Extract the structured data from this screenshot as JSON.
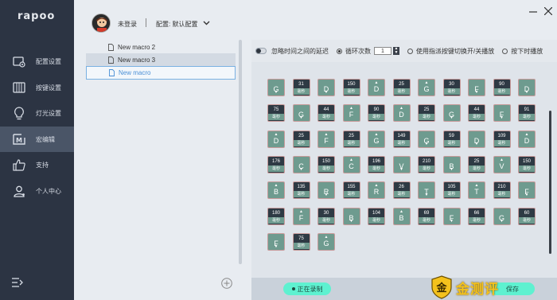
{
  "app": {
    "logo": "rapoo"
  },
  "sidebar": {
    "items": [
      {
        "label": "配置设置",
        "icon": "config-icon"
      },
      {
        "label": "按键设置",
        "icon": "keys-icon"
      },
      {
        "label": "灯光设置",
        "icon": "light-icon"
      },
      {
        "label": "宏编辑",
        "icon": "macro-icon"
      },
      {
        "label": "支持",
        "icon": "thumbs-up-icon"
      },
      {
        "label": "个人中心",
        "icon": "user-icon"
      }
    ],
    "active_index": 3,
    "collapse_icon": "menu-collapse-icon"
  },
  "header": {
    "login_status": "未登录",
    "profile_label": "配置: 默认配置"
  },
  "macro_list": {
    "items": [
      "New macro 2",
      "New macro 3",
      "New macro"
    ],
    "selected_index": 2
  },
  "editor": {
    "options": {
      "ignore_delay": "忽略时间之间的延迟",
      "loop_count_label": "循环次数",
      "loop_count_value": "1",
      "toggle_mode": "使用指派按键切换开/关播放",
      "hold_mode": "按下时播放"
    },
    "delay_unit": "毫秒",
    "events": [
      {
        "t": "k",
        "k": "G",
        "d": "down"
      },
      {
        "t": "d",
        "v": "31"
      },
      {
        "t": "k",
        "k": "D",
        "d": "down"
      },
      {
        "t": "d",
        "v": "150"
      },
      {
        "t": "k",
        "k": "D",
        "d": "up"
      },
      {
        "t": "d",
        "v": "25"
      },
      {
        "t": "k",
        "k": "G",
        "d": "up"
      },
      {
        "t": "d",
        "v": "30"
      },
      {
        "t": "k",
        "k": "F",
        "d": "down"
      },
      {
        "t": "d",
        "v": "90"
      },
      {
        "t": "k",
        "k": "D",
        "d": "down"
      },
      {
        "t": "d",
        "v": "75"
      },
      {
        "t": "k",
        "k": "G",
        "d": "down"
      },
      {
        "t": "d",
        "v": "44"
      },
      {
        "t": "k",
        "k": "F",
        "d": "up"
      },
      {
        "t": "d",
        "v": "90"
      },
      {
        "t": "k",
        "k": "D",
        "d": "up"
      },
      {
        "t": "d",
        "v": "25"
      },
      {
        "t": "k",
        "k": "G",
        "d": "down"
      },
      {
        "t": "d",
        "v": "44"
      },
      {
        "t": "k",
        "k": "F",
        "d": "down"
      },
      {
        "t": "d",
        "v": "91"
      },
      {
        "t": "k",
        "k": "D",
        "d": "up"
      },
      {
        "t": "d",
        "v": "25"
      },
      {
        "t": "k",
        "k": "F",
        "d": "up"
      },
      {
        "t": "d",
        "v": "25"
      },
      {
        "t": "k",
        "k": "G",
        "d": "up"
      },
      {
        "t": "d",
        "v": "149"
      },
      {
        "t": "k",
        "k": "G",
        "d": "down"
      },
      {
        "t": "d",
        "v": "59"
      },
      {
        "t": "k",
        "k": "D",
        "d": "down"
      },
      {
        "t": "d",
        "v": "109"
      },
      {
        "t": "k",
        "k": "D",
        "d": "up"
      },
      {
        "t": "d",
        "v": "176"
      },
      {
        "t": "k",
        "k": "C",
        "d": "down"
      },
      {
        "t": "d",
        "v": "150"
      },
      {
        "t": "k",
        "k": "C",
        "d": "up"
      },
      {
        "t": "d",
        "v": "196"
      },
      {
        "t": "k",
        "k": "V",
        "d": "down"
      },
      {
        "t": "d",
        "v": "210"
      },
      {
        "t": "k",
        "k": "B",
        "d": "down"
      },
      {
        "t": "d",
        "v": "25"
      },
      {
        "t": "k",
        "k": "V",
        "d": "up"
      },
      {
        "t": "d",
        "v": "150"
      },
      {
        "t": "k",
        "k": "B",
        "d": "up"
      },
      {
        "t": "d",
        "v": "135"
      },
      {
        "t": "k",
        "k": "R",
        "d": "down"
      },
      {
        "t": "d",
        "v": "155"
      },
      {
        "t": "k",
        "k": "R",
        "d": "up"
      },
      {
        "t": "d",
        "v": "26"
      },
      {
        "t": "k",
        "k": "T",
        "d": "down"
      },
      {
        "t": "d",
        "v": "105"
      },
      {
        "t": "k",
        "k": "T",
        "d": "up"
      },
      {
        "t": "d",
        "v": "210"
      },
      {
        "t": "k",
        "k": "F",
        "d": "down"
      },
      {
        "t": "d",
        "v": "180"
      },
      {
        "t": "k",
        "k": "F",
        "d": "up"
      },
      {
        "t": "d",
        "v": "30"
      },
      {
        "t": "k",
        "k": "B",
        "d": "down"
      },
      {
        "t": "d",
        "v": "104"
      },
      {
        "t": "k",
        "k": "B",
        "d": "up"
      },
      {
        "t": "d",
        "v": "69"
      },
      {
        "t": "k",
        "k": "F",
        "d": "down"
      },
      {
        "t": "d",
        "v": "66"
      },
      {
        "t": "k",
        "k": "G",
        "d": "down"
      },
      {
        "t": "d",
        "v": "60"
      },
      {
        "t": "k",
        "k": "F",
        "d": "down"
      },
      {
        "t": "d",
        "v": "75"
      },
      {
        "t": "k",
        "k": "G",
        "d": "up"
      }
    ]
  },
  "bottom": {
    "record_label": "正在录制",
    "save_label": "保存",
    "watermark": "金测评"
  },
  "colors": {
    "sidebar_bg": "#2c3443",
    "key_cell": "#6e9b8f",
    "delay_cell": "#2e3a44",
    "accent_button": "#5ef1d0",
    "selection_border": "#7ab1e2"
  }
}
